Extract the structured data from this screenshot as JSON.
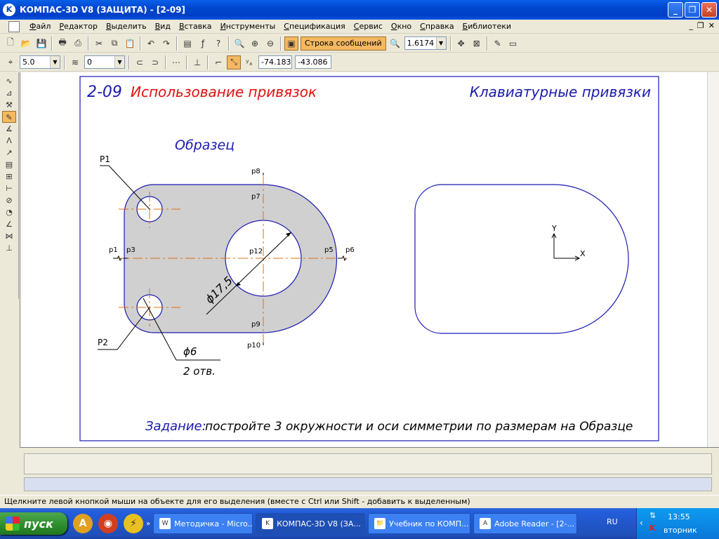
{
  "window": {
    "title": "КОМПАС-3D V8 (ЗАЩИТА) - [2-09]"
  },
  "menu": {
    "items": [
      "Файл",
      "Редактор",
      "Выделить",
      "Вид",
      "Вставка",
      "Инструменты",
      "Спецификация",
      "Сервис",
      "Окно",
      "Справка",
      "Библиотеки"
    ]
  },
  "toolbar": {
    "message_button_label": "Строка сообщений",
    "zoom_value": "1.6174",
    "step_value": "5.0",
    "layer_value": "0",
    "coord_x": "-74.183",
    "coord_y": "-43.086"
  },
  "drawing": {
    "number": "2-09",
    "title": "Использование привязок",
    "subtitle": "Клавиатурные привязки",
    "sample_label": "Образец",
    "task_label": "Задание:",
    "task_text": "постройте 3 окружности и оси симметрии по размерам на Образце",
    "points": {
      "p1": "p1",
      "p3": "p3",
      "p5": "p5",
      "p6": "p6",
      "p7": "p7",
      "p8": "p8",
      "p9": "p9",
      "p10": "p10",
      "p12": "p12"
    },
    "leader_p1": "P1",
    "leader_p2": "P2",
    "dim_big": "ϕ17,5",
    "dim_small": "ϕ6",
    "holes_note": "2 отв.",
    "axis_y": "Y",
    "axis_x": "X"
  },
  "status": {
    "text": "Щелкните левой кнопкой мыши на объекте для его выделения (вместе с Ctrl или Shift - добавить к выделенным)"
  },
  "taskbar": {
    "start_label": "пуск",
    "tasks": [
      "Методичка - Micro...",
      "КОМПАС-3D V8 (ЗА...",
      "Учебник по КОМП...",
      "Adobe Reader - [2-..."
    ],
    "lang": "RU",
    "time": "13:55",
    "day": "вторник"
  },
  "colors": {
    "frame": "#1a1ab0",
    "title_red": "#e01010",
    "part_fill": "#d0d0d0",
    "axis_orange": "#e07010"
  }
}
